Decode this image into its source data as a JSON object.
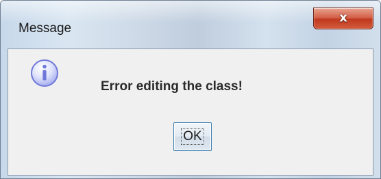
{
  "window": {
    "title": "Message"
  },
  "titlebar": {
    "close_label": "x",
    "close_icon": "close-icon"
  },
  "dialog": {
    "icon": "information-icon",
    "message": "Error editing the class!",
    "ok_label": "OK"
  },
  "colors": {
    "close_button": "#c7432a",
    "ok_border": "#3c7fb1",
    "info_icon": "#6f78d8"
  }
}
